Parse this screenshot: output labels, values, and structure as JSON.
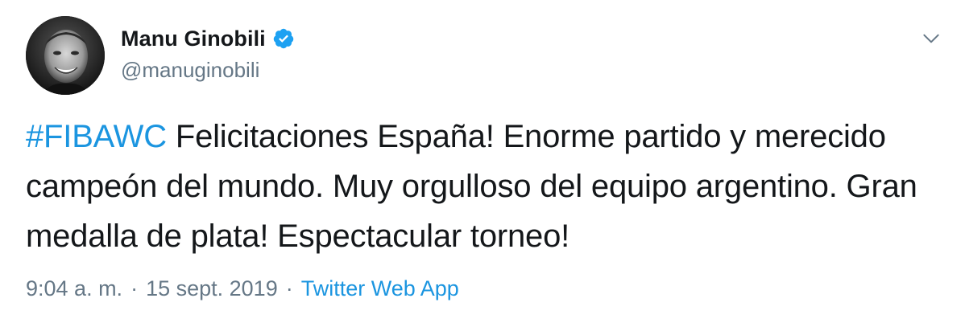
{
  "tweet": {
    "author": {
      "display_name": "Manu Ginobili",
      "handle": "@manuginobili",
      "verified": true
    },
    "text": {
      "hashtag": "#FIBAWC",
      "body": " Felicitaciones España! Enorme partido y merecido campeón del mundo. Muy orgulloso del equipo argentino. Gran medalla de plata! Espectacular torneo!"
    },
    "meta": {
      "time": "9:04 a. m.",
      "separator_1": "·",
      "date": "15 sept. 2019",
      "separator_2": "·",
      "source": "Twitter Web App"
    }
  },
  "colors": {
    "link": "#1b95e0",
    "secondary_text": "#657786",
    "primary_text": "#14171a",
    "verified_badge": "#1da1f2"
  },
  "icons": {
    "verified": "verified-badge-icon",
    "menu": "chevron-down-icon"
  }
}
